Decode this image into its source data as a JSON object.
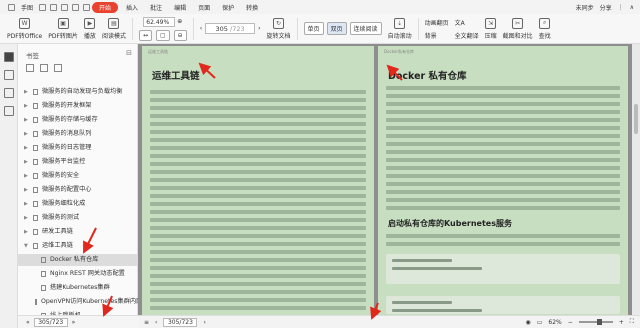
{
  "menubar": {
    "items": [
      "手图",
      "开始",
      "插入",
      "批注",
      "编辑",
      "页面",
      "保护",
      "转换"
    ],
    "active_index": 1,
    "right": {
      "sync": "未同步",
      "share": "分享"
    }
  },
  "toolbar": {
    "pdf_office": "PDF转Office",
    "pdf_image": "PDF转图片",
    "play": "播放",
    "read_mode": "阅读模式",
    "zoom": "62.49%",
    "page_current": "305",
    "page_total": "723",
    "rotate_doc": "旋转文档",
    "single_page": "单页",
    "double_page": "双页",
    "continuous": "连续阅读",
    "auto_scroll": "自动滚动",
    "anim": "动画翻页",
    "background": "背景",
    "full_translate": "全文翻译",
    "compress": "压缩",
    "screenshot_compare": "截图和对比",
    "search": "查找"
  },
  "sidebar": {
    "title": "书签",
    "items": [
      {
        "label": "微服务的自动发现与负载均衡",
        "level": 0,
        "caret": "▶"
      },
      {
        "label": "微服务的开发框架",
        "level": 0,
        "caret": "▶"
      },
      {
        "label": "微服务的存储与缓存",
        "level": 0,
        "caret": "▶"
      },
      {
        "label": "微服务的消息队列",
        "level": 0,
        "caret": "▶"
      },
      {
        "label": "微服务的日志管理",
        "level": 0,
        "caret": "▶"
      },
      {
        "label": "微服务平台监控",
        "level": 0,
        "caret": "▶"
      },
      {
        "label": "微服务的安全",
        "level": 0,
        "caret": "▶"
      },
      {
        "label": "微服务的配置中心",
        "level": 0,
        "caret": "▶"
      },
      {
        "label": "微服务细粒化成",
        "level": 0,
        "caret": "▶"
      },
      {
        "label": "微服务的测试",
        "level": 0,
        "caret": "▶"
      },
      {
        "label": "研发工具链",
        "level": 0,
        "caret": "▶"
      },
      {
        "label": "运维工具链",
        "level": 0,
        "caret": "▼"
      },
      {
        "label": "Docker 私有仓库",
        "level": 1,
        "caret": "",
        "selected": true
      },
      {
        "label": "Nginx REST 网关动态配置",
        "level": 1,
        "caret": ""
      },
      {
        "label": "搭建Kubernetes集群",
        "level": 1,
        "caret": ""
      },
      {
        "label": "OpenVPN访问Kubernetes集群内网",
        "level": 1,
        "caret": ""
      },
      {
        "label": "线上跳板机",
        "level": 1,
        "caret": ""
      }
    ],
    "footer": {
      "page": "305",
      "total": "723"
    }
  },
  "document": {
    "left_header": "运维工具链",
    "left_title": "运维工具链",
    "right_header": "Docker私有仓库",
    "right_title": "Docker 私有仓库",
    "right_subtitle": "启动私有仓库的Kubernetes服务"
  },
  "status": {
    "page": "305",
    "total": "723",
    "zoom": "62%"
  },
  "colors": {
    "accent": "#e8432f",
    "page_bg": "#c7dec0",
    "annotation": "#e0281c"
  }
}
